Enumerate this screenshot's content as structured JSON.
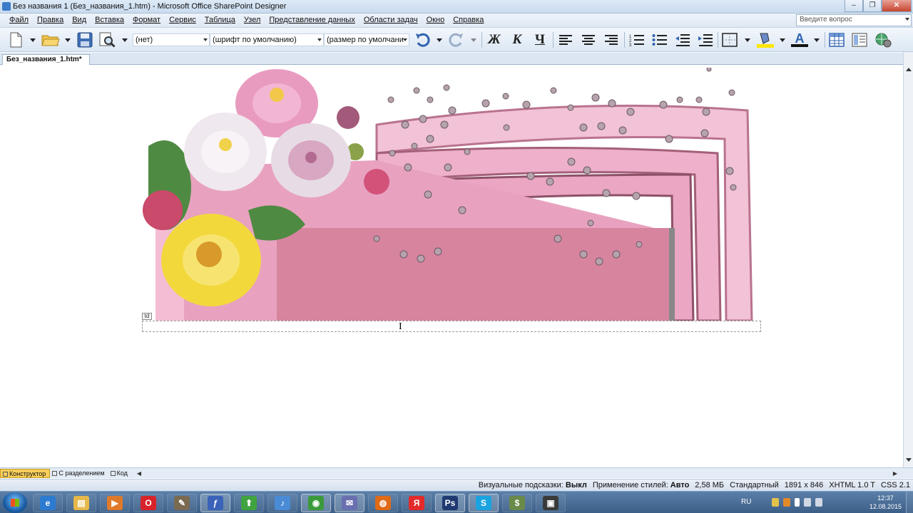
{
  "window": {
    "title": "Без названия 1 (Без_названия_1.htm) - Microsoft Office SharePoint Designer"
  },
  "menu": {
    "items": [
      "Файл",
      "Правка",
      "Вид",
      "Вставка",
      "Формат",
      "Сервис",
      "Таблица",
      "Узел",
      "Представление данных",
      "Области задач",
      "Окно",
      "Справка"
    ],
    "ask_placeholder": "Введите вопрос"
  },
  "toolbar": {
    "style_value": "(нет)",
    "font_value": "(шрифт по умолчанию)",
    "size_value": "(размер по умолчани",
    "bold": "Ж",
    "italic": "К",
    "underline": "Ч",
    "font_color_glyph": "A"
  },
  "document": {
    "tab_label": "Без_названия_1.htm*",
    "td_tag": "td"
  },
  "colors": {
    "banner_pink": "#e8a2c0",
    "banner_dark": "#c47ea1",
    "flower_yellow": "#f3d83c",
    "highlight_yellow": "#ffe600",
    "font_red": "#e02020"
  },
  "views": {
    "design": "Конструктор",
    "split": "С разделением",
    "code": "Код"
  },
  "status": {
    "visual_aids_label": "Визуальные подсказки:",
    "visual_aids_value": "Выкл",
    "style_app_label": "Применение стилей:",
    "style_app_value": "Авто",
    "size": "2,58 МБ",
    "mode": "Стандартный",
    "dimensions": "1891 x 846",
    "doctype": "XHTML 1.0 T",
    "css": "CSS 2.1"
  },
  "taskbar": {
    "apps": [
      {
        "name": "internet-explorer",
        "glyph": "e",
        "color": "#2d7bd1",
        "state": "pinned"
      },
      {
        "name": "file-explorer",
        "glyph": "▤",
        "color": "#e6b84a",
        "state": "pinned"
      },
      {
        "name": "media-player",
        "glyph": "▶",
        "color": "#e07a2a",
        "state": "pinned"
      },
      {
        "name": "opera",
        "glyph": "O",
        "color": "#d8232a",
        "state": "pinned"
      },
      {
        "name": "gimp",
        "glyph": "✎",
        "color": "#7a6a50",
        "state": "pinned"
      },
      {
        "name": "sharepoint-designer",
        "glyph": "ƒ",
        "color": "#3a62b8",
        "state": "running"
      },
      {
        "name": "upload-arrow",
        "glyph": "⬆",
        "color": "#3fa33f",
        "state": "pinned"
      },
      {
        "name": "audio",
        "glyph": "♪",
        "color": "#4a8bd6",
        "state": "pinned"
      },
      {
        "name": "chrome",
        "glyph": "◉",
        "color": "#3a9a3a",
        "state": "running"
      },
      {
        "name": "mail-client",
        "glyph": "✉",
        "color": "#6a6fb0",
        "state": "running"
      },
      {
        "name": "firefox",
        "glyph": "◍",
        "color": "#e06a16",
        "state": "pinned"
      },
      {
        "name": "yandex",
        "glyph": "Я",
        "color": "#e22a2a",
        "state": "pinned"
      },
      {
        "name": "photoshop",
        "glyph": "Ps",
        "color": "#1f3a70",
        "state": "running"
      },
      {
        "name": "skype",
        "glyph": "S",
        "color": "#1aa3e0",
        "state": "running"
      },
      {
        "name": "money-app",
        "glyph": "$",
        "color": "#6a8a4a",
        "state": "pinned"
      },
      {
        "name": "tool-app",
        "glyph": "▣",
        "color": "#3a3a3a",
        "state": "pinned"
      }
    ],
    "lang": "RU",
    "time": "12:37",
    "date": "12.08.2015"
  }
}
